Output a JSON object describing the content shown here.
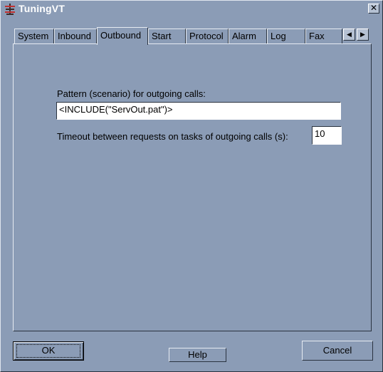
{
  "window": {
    "title": "TuningVT",
    "close_glyph": "✕"
  },
  "tabs": [
    {
      "label": "System",
      "active": false
    },
    {
      "label": "Inbound",
      "active": false
    },
    {
      "label": "Outbound",
      "active": true
    },
    {
      "label": "Start",
      "active": false
    },
    {
      "label": "Protocol",
      "active": false
    },
    {
      "label": "Alarm",
      "active": false
    },
    {
      "label": "Log",
      "active": false
    },
    {
      "label": "Fax",
      "active": false
    }
  ],
  "tab_scroll": {
    "left_glyph": "◀",
    "right_glyph": "▶"
  },
  "outbound": {
    "pattern_label": "Pattern (scenario) for outgoing calls:",
    "pattern_value": "<INCLUDE(\"ServOut.pat\")>",
    "timeout_label": "Timeout between requests on tasks of outgoing calls (s):",
    "timeout_value": "10"
  },
  "buttons": {
    "ok": "OK",
    "help": "Help",
    "cancel": "Cancel"
  },
  "icons": {
    "app": "tuning-app-icon",
    "close": "close-icon",
    "scroll_left": "scroll-left-icon",
    "scroll_right": "scroll-right-icon"
  }
}
